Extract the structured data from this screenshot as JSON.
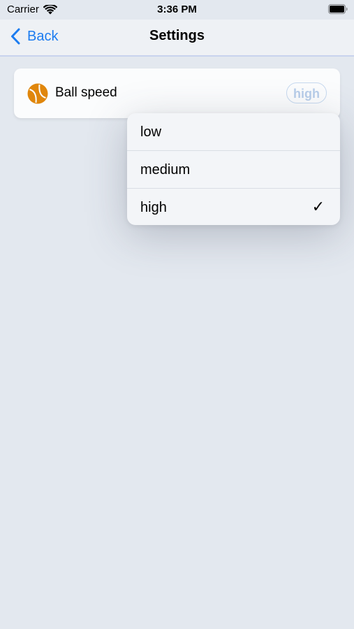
{
  "status_bar": {
    "carrier": "Carrier",
    "time": "3:36 PM"
  },
  "nav": {
    "back_label": "Back",
    "title": "Settings"
  },
  "setting": {
    "label": "Ball speed",
    "value": "high",
    "icon": "tennis-ball-icon"
  },
  "menu": {
    "items": [
      {
        "label": "low"
      },
      {
        "label": "medium"
      },
      {
        "label": "high",
        "selected_mark": "✓"
      }
    ]
  },
  "colors": {
    "accent": "#1c7cf0",
    "background": "#e3e8ef",
    "ball": "#e0860b"
  }
}
